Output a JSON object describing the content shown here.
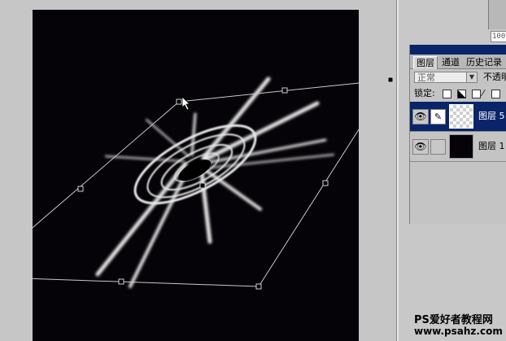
{
  "zoom_field": "100",
  "layers_panel": {
    "tabs": [
      "图层",
      "通道",
      "历史记录"
    ],
    "blend_mode": "正常",
    "opacity_label": "不透明",
    "lock_label": "锁定:",
    "layers": [
      {
        "name": "图层 5",
        "selected": true,
        "visible": true,
        "thumbnail": "transparent"
      },
      {
        "name": "图层 1",
        "selected": false,
        "visible": true,
        "thumbnail": "black"
      }
    ]
  },
  "watermark": {
    "line1": "PS爱好者教程网",
    "line2": "www.psahz.com"
  },
  "icons": {
    "eye": "eye-icon",
    "brush": "brush-icon",
    "cursor": "move-cursor-icon"
  },
  "colors": {
    "canvas": "#050307",
    "panel_titlebar": "#0a246a",
    "selection": "#0a246a",
    "ui_gray": "#c4c4c4"
  }
}
